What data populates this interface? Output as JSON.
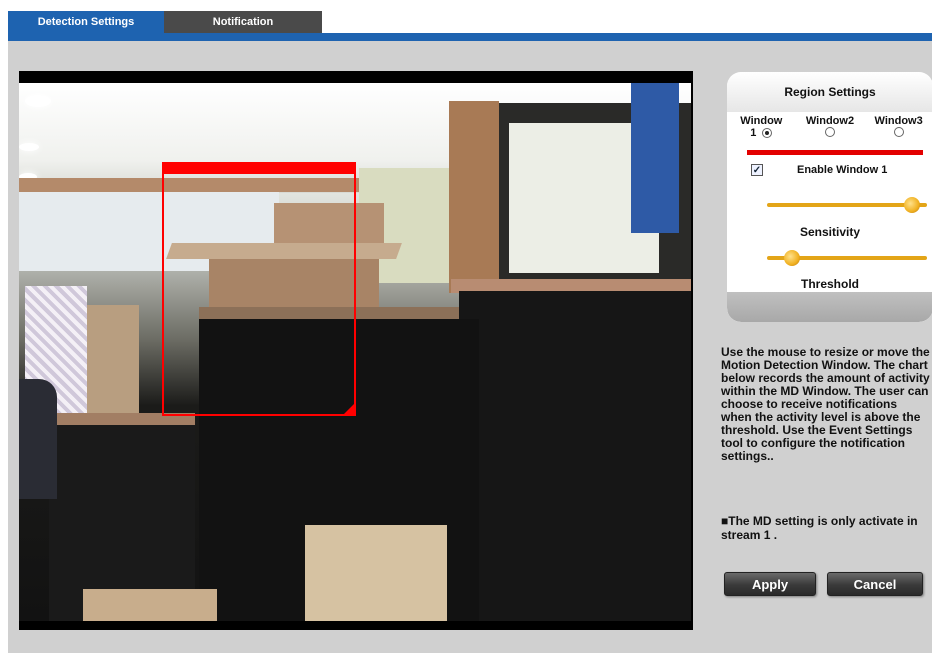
{
  "tabs": [
    {
      "label": "Detection Settings",
      "active": true
    },
    {
      "label": "Notification",
      "active": false
    }
  ],
  "colors": {
    "accent": "#1e63b0",
    "md_window": "#ff0000",
    "slider": "#e3a518"
  },
  "region": {
    "title": "Region Settings",
    "windows": [
      {
        "label": "Window",
        "number": "1",
        "selected": true
      },
      {
        "label": "Window2",
        "number": "",
        "selected": false
      },
      {
        "label": "Window3",
        "number": "",
        "selected": false
      }
    ],
    "enable_label": "Enable Window 1",
    "enable_checked": true,
    "sensitivity_label": "Sensitivity",
    "sensitivity_value": 0.95,
    "threshold_label": "Threshold",
    "threshold_value": 0.12
  },
  "help_text": "Use the mouse to resize or move the Motion Detection Window. The chart below records the amount of activity within the MD Window. The user can choose to receive notifications when the activity level is above the threshold. Use the Event Settings tool to configure the notification settings..",
  "note": {
    "icon": "bullet-icon",
    "text": "The MD setting is only activate in stream 1 ."
  },
  "buttons": {
    "apply": "Apply",
    "cancel": "Cancel"
  },
  "icons": {
    "checkbox": "check-icon",
    "radio": "radio-icon"
  }
}
